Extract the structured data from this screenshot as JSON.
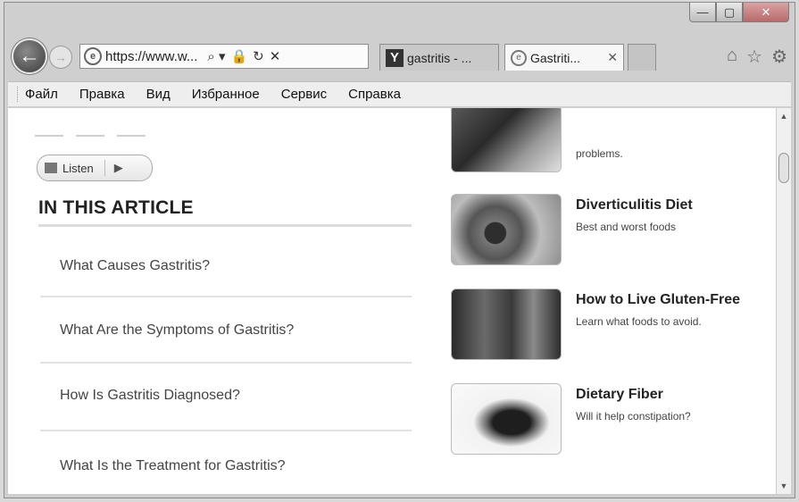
{
  "window": {
    "minimize": "—",
    "maximize": "▢",
    "close": "✕"
  },
  "nav": {
    "back_glyph": "←",
    "forward_glyph": "→",
    "url": "https://www.w...",
    "search_glyph": "⌕ ▾",
    "lock_glyph": "🔒",
    "refresh_glyph": "↻",
    "stop_glyph": "✕"
  },
  "tabs": [
    {
      "label": "gastritis - ...",
      "icon": "yandex-icon",
      "icon_text": "Y"
    },
    {
      "label": "Gastriti...",
      "icon": "ie-page-icon",
      "close": "✕"
    }
  ],
  "tools": {
    "home": "⌂",
    "favorites": "☆",
    "settings": "⚙"
  },
  "menu": [
    "Файл",
    "Правка",
    "Вид",
    "Избранное",
    "Сервис",
    "Справка"
  ],
  "article": {
    "listen_label": "Listen",
    "listen_play": "▶",
    "heading": "IN THIS ARTICLE",
    "toc": [
      "What Causes Gastritis?",
      "What Are the Symptoms of Gastritis?",
      "How Is Gastritis Diagnosed?",
      "What Is the Treatment for Gastritis?"
    ]
  },
  "related": [
    {
      "title": "",
      "subtitle": "problems."
    },
    {
      "title": "Diverticulitis Diet",
      "subtitle": "Best and worst foods"
    },
    {
      "title": "How to Live Gluten-Free",
      "subtitle": "Learn what foods to avoid."
    },
    {
      "title": "Dietary Fiber",
      "subtitle": "Will it help constipation?"
    }
  ]
}
